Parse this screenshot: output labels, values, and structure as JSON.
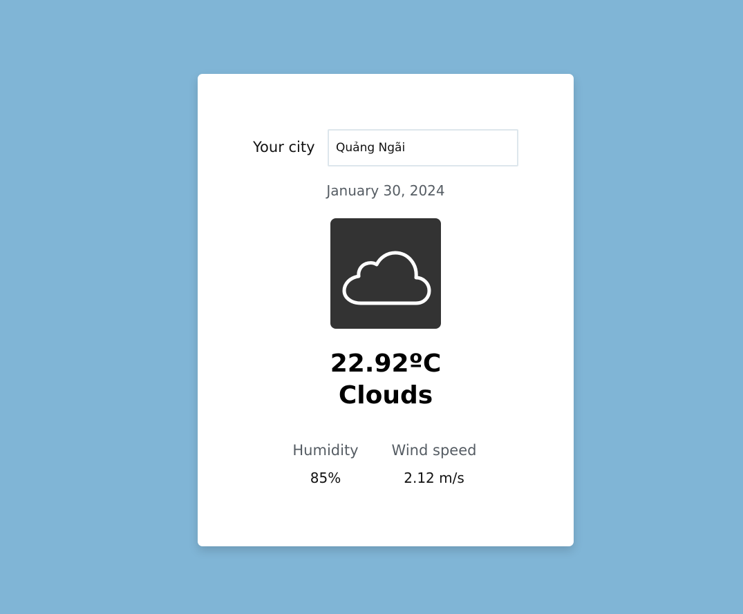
{
  "search": {
    "label": "Your city",
    "value": "Quảng Ngãi"
  },
  "weather": {
    "date": "January 30, 2024",
    "icon": "cloud-icon",
    "temperature": "22.92ºC",
    "condition": "Clouds"
  },
  "stats": {
    "humidity_label": "Humidity",
    "humidity_value": "85%",
    "wind_label": "Wind speed",
    "wind_value": "2.12 m/s"
  },
  "colors": {
    "background": "#80b5d6",
    "card": "#ffffff",
    "icon_box": "#333333",
    "muted_text": "#555c63"
  }
}
